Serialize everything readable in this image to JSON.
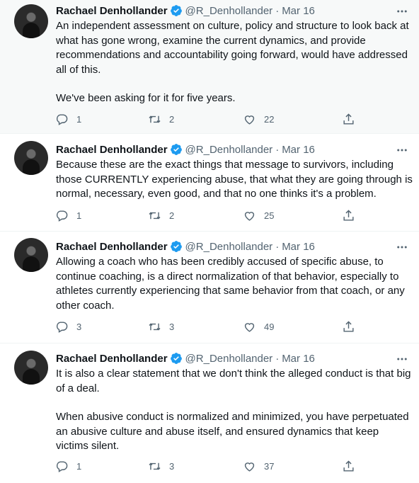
{
  "tweets": [
    {
      "name": "Rachael Denhollander",
      "handle": "@R_Denhollander",
      "separator": "·",
      "date": "Mar 16",
      "paragraphs": [
        "An independent assessment on culture, policy and structure to look back at what has gone wrong, examine the current dynamics, and provide recommendations and accountability going forward, would have addressed all of this.",
        "We've been asking for it for five years."
      ],
      "replies": "1",
      "retweets": "2",
      "likes": "22"
    },
    {
      "name": "Rachael Denhollander",
      "handle": "@R_Denhollander",
      "separator": "·",
      "date": "Mar 16",
      "paragraphs": [
        "Because these are the exact things that message to survivors, including those CURRENTLY experiencing abuse, that what they are going through is normal, necessary, even good, and that no one thinks it's a problem."
      ],
      "replies": "1",
      "retweets": "2",
      "likes": "25"
    },
    {
      "name": "Rachael Denhollander",
      "handle": "@R_Denhollander",
      "separator": "·",
      "date": "Mar 16",
      "paragraphs": [
        "Allowing a coach who has been credibly accused of specific abuse, to continue coaching, is a direct normalization of that behavior, especially to athletes currently experiencing that same behavior from that coach, or any other coach."
      ],
      "replies": "3",
      "retweets": "3",
      "likes": "49"
    },
    {
      "name": "Rachael Denhollander",
      "handle": "@R_Denhollander",
      "separator": "·",
      "date": "Mar 16",
      "paragraphs": [
        "It is also a clear statement that we don't think the alleged conduct is that big of a deal.",
        "When abusive conduct is normalized and minimized, you have perpetuated an abusive culture and abuse itself, and ensured dynamics that keep victims silent."
      ],
      "replies": "1",
      "retweets": "3",
      "likes": "37"
    }
  ],
  "icons": {
    "verified": "verified-badge-icon",
    "more": "more-icon",
    "reply": "reply-icon",
    "retweet": "retweet-icon",
    "like": "like-icon",
    "share": "share-icon"
  },
  "colors": {
    "text": "#0f1419",
    "muted": "#536471",
    "verified": "#1d9bf0",
    "highlight": "#f7f9f9"
  }
}
